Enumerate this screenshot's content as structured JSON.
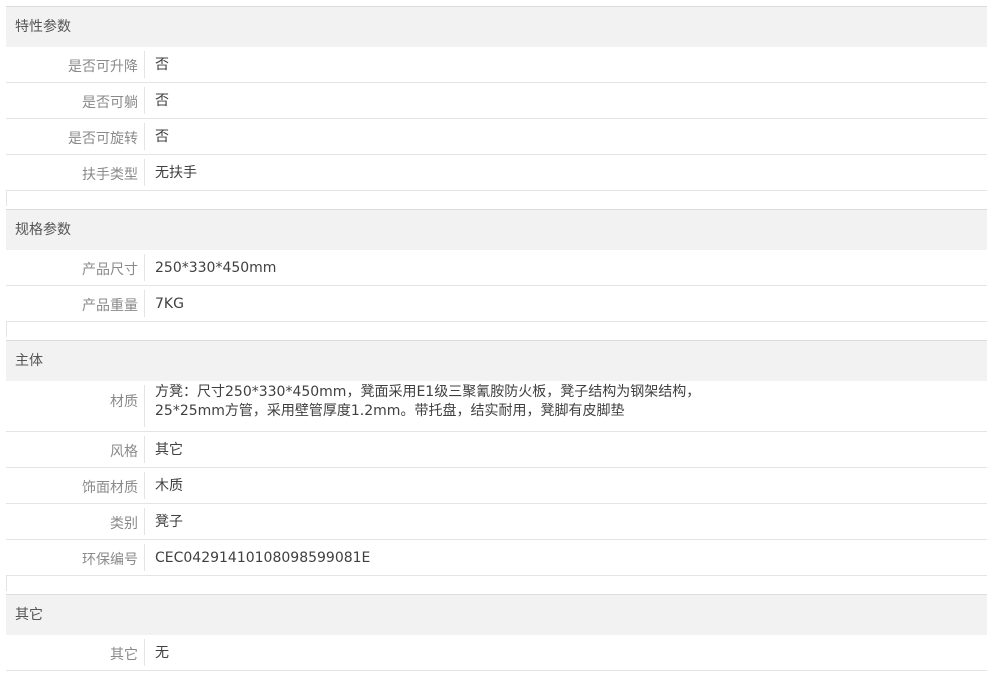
{
  "sections": [
    {
      "title": "特性参数",
      "rows": [
        {
          "label": "是否可升降",
          "value": "否"
        },
        {
          "label": "是否可躺",
          "value": "否"
        },
        {
          "label": "是否可旋转",
          "value": "否"
        },
        {
          "label": "扶手类型",
          "value": "无扶手"
        }
      ]
    },
    {
      "title": "规格参数",
      "rows": [
        {
          "label": "产品尺寸",
          "value": "250*330*450mm"
        },
        {
          "label": "产品重量",
          "value": "7KG"
        }
      ]
    },
    {
      "title": "主体",
      "rows": [
        {
          "label": "材质",
          "value_line1": "方凳：尺寸250*330*450mm，凳面采用E1级三聚氰胺防火板，凳子结构为钢架结构，",
          "value_line2": "25*25mm方管，采用壁管厚度1.2mm。带托盘，结实耐用，凳脚有皮脚垫"
        },
        {
          "label": "风格",
          "value": "其它"
        },
        {
          "label": "饰面材质",
          "value": "木质"
        },
        {
          "label": "类别",
          "value": "凳子"
        },
        {
          "label": "环保编号",
          "value": "CEC04291410108098599081E"
        }
      ]
    },
    {
      "title": "其它",
      "rows": [
        {
          "label": "其它",
          "value": "无"
        }
      ]
    }
  ]
}
